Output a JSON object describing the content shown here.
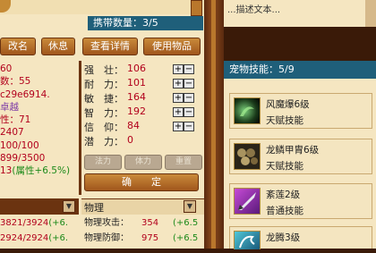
{
  "top": {
    "carry_label": "携带数量：3/5"
  },
  "buttons": [
    {
      "label": "改名"
    },
    {
      "label": "休息"
    },
    {
      "label": "查看详情"
    },
    {
      "label": "使用物品"
    }
  ],
  "left_values": [
    "60",
    "数：55",
    "c29e6914.",
    "卓越",
    "性：71",
    "2407",
    "100/100",
    "899/3500",
    "13"
  ],
  "left_growth_bonus": "(属性+6.5%)",
  "stats": [
    {
      "label": "强　壮：",
      "value": "106"
    },
    {
      "label": "耐　力：",
      "value": "101"
    },
    {
      "label": "敏　捷：",
      "value": "164"
    },
    {
      "label": "智　力：",
      "value": "192"
    },
    {
      "label": "信　仰：",
      "value": "84"
    },
    {
      "label": "潜　力：",
      "value": "0"
    }
  ],
  "disabled_buttons": [
    "法力",
    "体力",
    "重置"
  ],
  "confirm": {
    "label": "确　　定"
  },
  "bottom_left": {
    "row1_value": "3821/3924",
    "row1_bonus": "(+6.",
    "row2_value": "2924/2924",
    "row2_bonus": "(+6."
  },
  "physical": {
    "header": "物理",
    "rows": [
      {
        "label": "物理攻击：",
        "value": "354",
        "bonus": "(+6.5"
      },
      {
        "label": "物理防御：",
        "value": "975",
        "bonus": "(+6.5"
      }
    ]
  },
  "pet_skills": {
    "header": "宠物技能：5/9",
    "items": [
      {
        "name": "风魔爆6级",
        "type": "天赋技能",
        "icon": "whirlwind-icon"
      },
      {
        "name": "龙鳞甲胄6级",
        "type": "天赋技能",
        "icon": "dragon-scale-icon"
      },
      {
        "name": "紊莲2级",
        "type": "普通技能",
        "icon": "lotus-blade-icon"
      },
      {
        "name": "龙腾3级",
        "type": "",
        "icon": "dragon-rise-icon"
      }
    ]
  },
  "top_right_text": "...描述文本...",
  "colors": {
    "teal": "#1f5f7a",
    "brown": "#a0561c",
    "parchment": "#f5e6c1",
    "red_value": "#b2001c",
    "green_bonus": "#1d8a1a"
  }
}
